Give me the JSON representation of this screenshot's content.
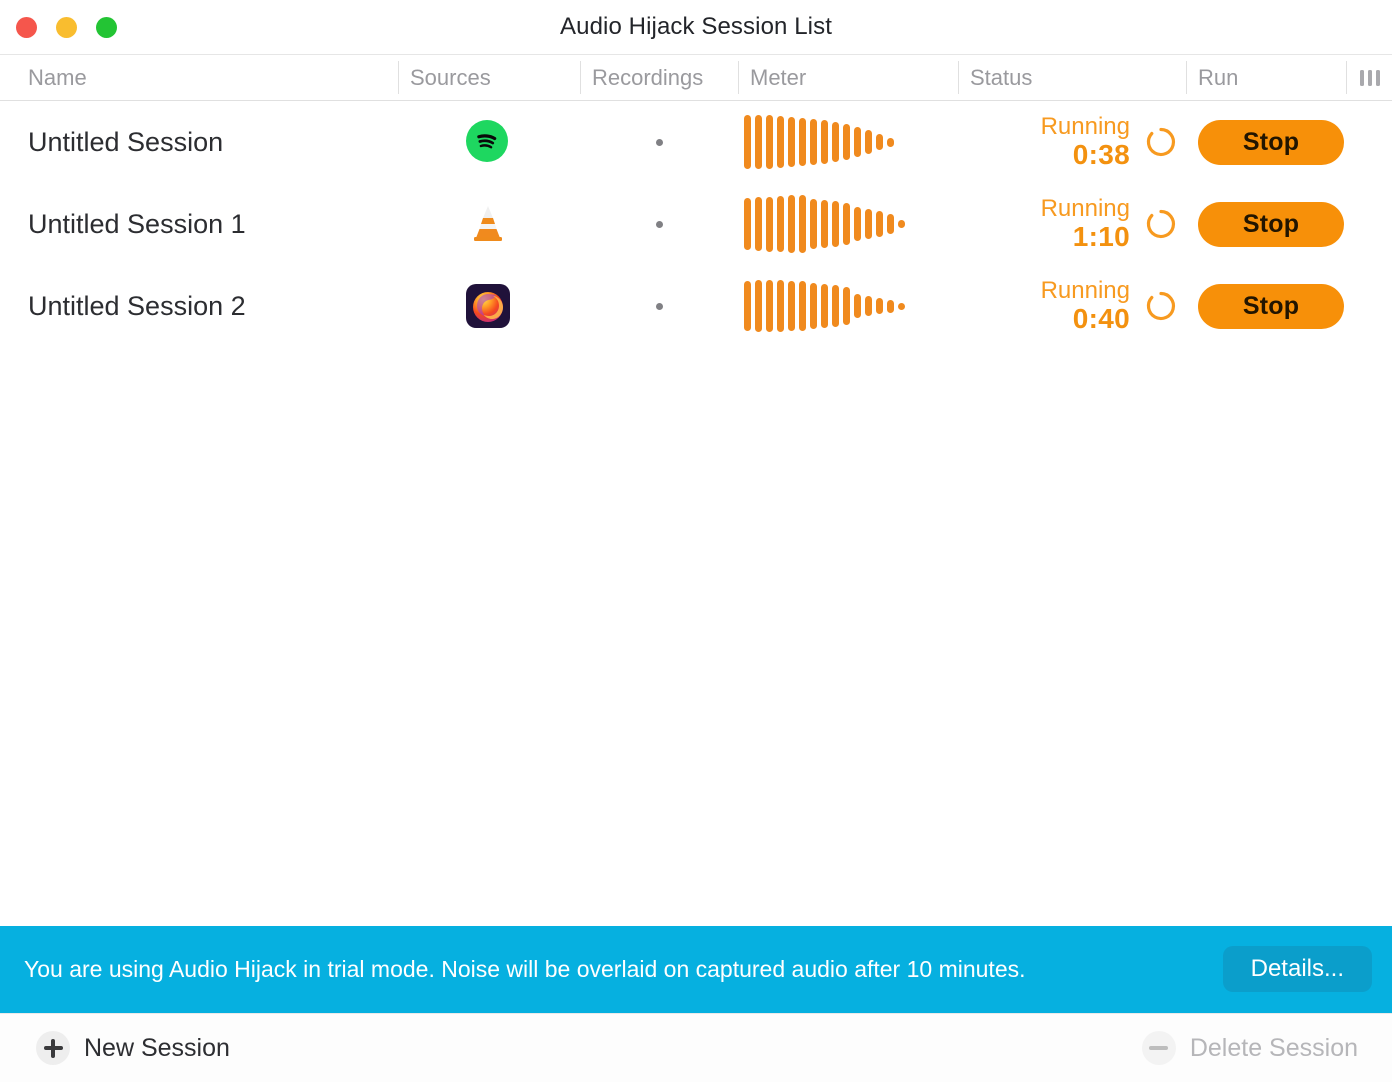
{
  "window": {
    "title": "Audio Hijack Session List",
    "traffic_lights": [
      {
        "name": "close",
        "color": "#f5564c"
      },
      {
        "name": "minimize",
        "color": "#f9bd2f"
      },
      {
        "name": "zoom",
        "color": "#23c434"
      }
    ]
  },
  "columns": [
    {
      "key": "name",
      "label": "Name"
    },
    {
      "key": "sources",
      "label": "Sources"
    },
    {
      "key": "recordings",
      "label": "Recordings"
    },
    {
      "key": "meter",
      "label": "Meter"
    },
    {
      "key": "status",
      "label": "Status"
    },
    {
      "key": "run",
      "label": "Run"
    },
    {
      "key": "options",
      "label": "",
      "icon": "column-options-icon"
    }
  ],
  "sessions": [
    {
      "name": "Untitled Session",
      "source_icon": "spotify-icon",
      "recording_indicator": "dot",
      "meter_levels": [
        54,
        54,
        54,
        52,
        50,
        48,
        46,
        44,
        40,
        36,
        30,
        24,
        16,
        9
      ],
      "status_label": "Running",
      "status_time": "0:38",
      "status_icon": "refresh-spinner-icon",
      "run_label": "Stop"
    },
    {
      "name": "Untitled Session 1",
      "source_icon": "vlc-icon",
      "recording_indicator": "dot",
      "meter_levels": [
        52,
        54,
        55,
        56,
        58,
        58,
        50,
        48,
        46,
        42,
        34,
        30,
        26,
        20,
        8
      ],
      "status_label": "Running",
      "status_time": "1:10",
      "status_icon": "refresh-spinner-icon",
      "run_label": "Stop"
    },
    {
      "name": "Untitled Session 2",
      "source_icon": "firefox-icon",
      "recording_indicator": "dot",
      "meter_levels": [
        50,
        52,
        52,
        52,
        50,
        50,
        46,
        44,
        42,
        38,
        24,
        20,
        16,
        13,
        7
      ],
      "status_label": "Running",
      "status_time": "0:40",
      "status_icon": "refresh-spinner-icon",
      "run_label": "Stop"
    }
  ],
  "banner": {
    "message": "You are using Audio Hijack in trial mode. Noise will be overlaid on captured audio after 10 minutes.",
    "button_label": "Details...",
    "background_color": "#06b0e0"
  },
  "toolbar": {
    "new_session_label": "New Session",
    "delete_session_label": "Delete Session",
    "delete_enabled": false
  },
  "colors": {
    "accent_orange": "#f79009",
    "meter_orange": "#f08a1e",
    "status_orange": "#f3910f",
    "banner_blue": "#06b0e0",
    "header_text": "#9a9a9e"
  }
}
